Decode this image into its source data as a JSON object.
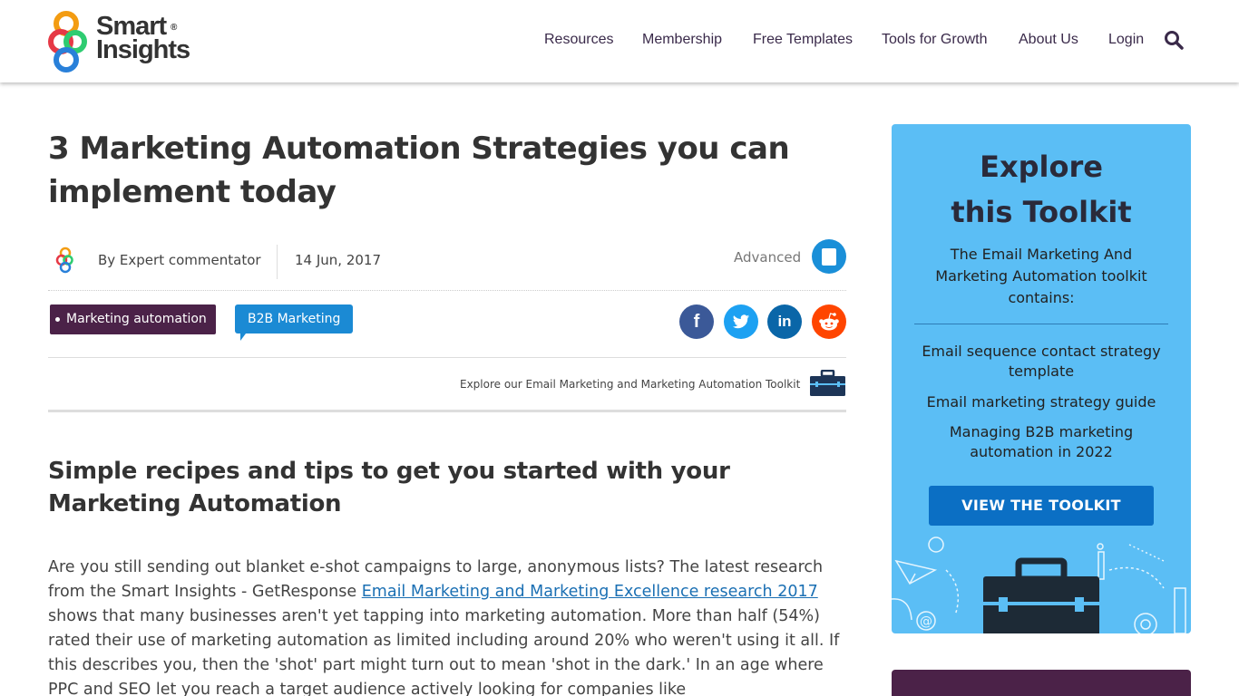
{
  "header": {
    "logo": {
      "line1": "Smart",
      "line2": "Insights",
      "reg": "®"
    },
    "nav": [
      {
        "label": "Resources"
      },
      {
        "label": "Membership"
      },
      {
        "label": "Free Templates"
      },
      {
        "label": "Tools for Growth"
      },
      {
        "label": "About Us"
      },
      {
        "label": "Login"
      }
    ],
    "search_icon": "search-icon"
  },
  "article": {
    "title": "3 Marketing Automation Strategies you can implement today",
    "author": "By Expert commentator",
    "date": "14 Jun, 2017",
    "level": "Advanced",
    "tags": [
      "Marketing automation",
      "B2B Marketing"
    ],
    "share_icons": [
      "facebook-icon",
      "twitter-icon",
      "linkedin-icon",
      "reddit-icon"
    ],
    "toolkit_link": "Explore our Email Marketing and Marketing Automation Toolkit",
    "subtitle": "Simple recipes and tips to get you started with your Marketing Automation",
    "body_part1": "Are you still sending out blanket e-shot campaigns to large, anonymous lists? The latest research from the Smart Insights - GetResponse ",
    "body_link": "Email Marketing and Marketing Excellence research 2017",
    "body_part2": " shows that many businesses aren't yet tapping into marketing automation. More than half (54%) rated their use of marketing automation as limited including around 20% who weren't using it all.  If this describes you, then the 'shot' part might turn out to mean 'shot in the dark.' In an age where PPC and SEO let you reach a target audience actively looking for companies like"
  },
  "sidebar": {
    "title": "Explore this Toolkit",
    "description": "The Email Marketing And Marketing Automation toolkit contains:",
    "items": [
      "Email sequence contact strategy template",
      "Email marketing strategy guide",
      "Managing B2B marketing automation in 2022"
    ],
    "button": "VIEW THE TOOLKIT"
  },
  "colors": {
    "purple": "#4b2248",
    "blue": "#1b8ad4",
    "sidebar_bg": "#5bbef5",
    "button_bg": "#0b6fc4"
  }
}
